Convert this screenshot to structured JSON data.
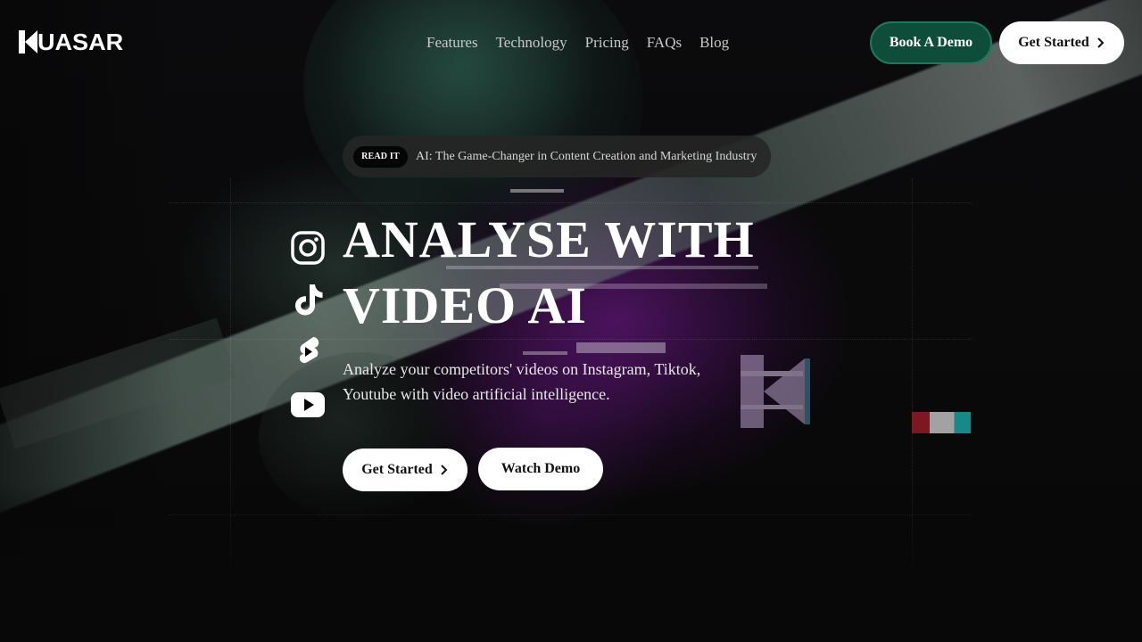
{
  "brand": {
    "name": "UASAR",
    "logo_icon": "quasar-k-icon"
  },
  "nav": {
    "links": [
      "Features",
      "Technology",
      "Pricing",
      "FAQs",
      "Blog"
    ],
    "book_demo_label": "Book A Demo",
    "get_started_label": "Get Started"
  },
  "announcement": {
    "badge": "READ IT",
    "text": "AI: The Game-Changer in Content Creation and Marketing Industry"
  },
  "hero": {
    "title_line1": "ANALYSE WITH",
    "title_line2": "VIDEO AI",
    "subtitle": "Analyze your competitors' videos on Instagram, Tiktok, Youtube with video artificial intelligence.",
    "primary_cta": "Get Started",
    "secondary_cta": "Watch Demo"
  },
  "socials": [
    "instagram-icon",
    "tiktok-icon",
    "youtube-shorts-icon",
    "youtube-icon"
  ],
  "colors": {
    "demo_button": "#0f4d3b",
    "demo_border": "#1c7a5c",
    "background": "#050505",
    "glow": "#7a1996"
  }
}
